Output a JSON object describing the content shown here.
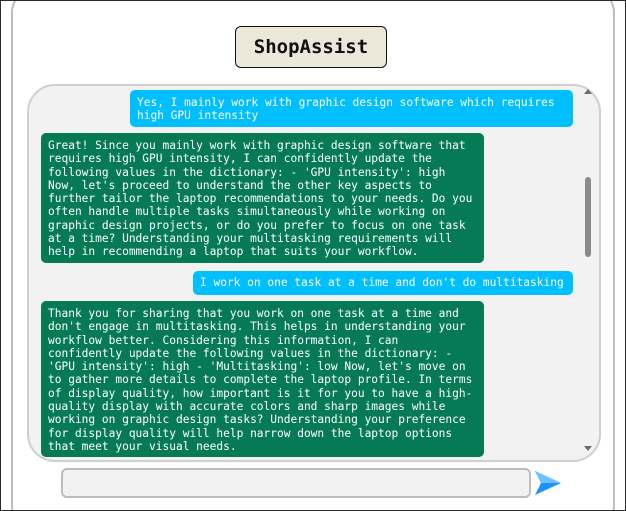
{
  "app": {
    "title": "ShopAssist"
  },
  "chat": {
    "messages": [
      {
        "role": "user",
        "text": "Yes, I mainly work with graphic design software which requires high GPU intensity"
      },
      {
        "role": "assistant",
        "text": "Great! Since you mainly work with graphic design software that requires high GPU intensity, I can confidently update the following values in the dictionary: - 'GPU intensity': high Now, let's proceed to understand the other key aspects to further tailor the laptop recommendations to your needs. Do you often handle multiple tasks simultaneously while working on graphic design projects, or do you prefer to focus on one task at a time? Understanding your multitasking requirements will help in recommending a laptop that suits your workflow."
      },
      {
        "role": "user",
        "text": "I work on one task at a time and don't do multitasking"
      },
      {
        "role": "assistant",
        "text": "Thank you for sharing that you work on one task at a time and don't engage in multitasking. This helps in understanding your workflow better. Considering this information, I can confidently update the following values in the dictionary: - 'GPU intensity': high - 'Multitasking': low Now, let's move on to gather more details to complete the laptop profile. In terms of display quality, how important is it for you to have a high-quality display with accurate colors and sharp images while working on graphic design tasks? Understanding your preference for display quality will help narrow down the laptop options that meet your visual needs."
      }
    ]
  },
  "input": {
    "value": "",
    "placeholder": ""
  },
  "icons": {
    "send": "send-arrow-icon",
    "scroll_up": "scroll-up-arrow-icon",
    "scroll_down": "scroll-down-arrow-icon"
  },
  "colors": {
    "user_bubble": "#00bfff",
    "assistant_bubble": "#057a55",
    "title_background": "#ebe7d9",
    "send_icon": "#1e90ff"
  }
}
